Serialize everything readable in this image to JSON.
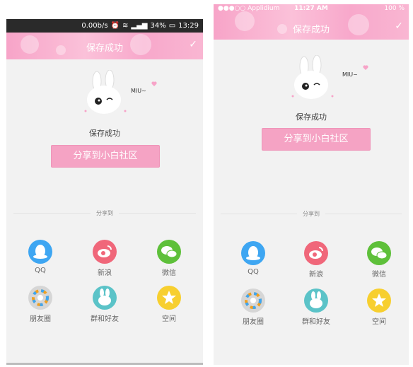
{
  "android_status": {
    "speed": "0.00b/s",
    "battery": "34%",
    "time": "13:29"
  },
  "ios_status": {
    "carrier": "●●●○○ Applidium",
    "time": "11:27 AM",
    "battery": "100 %"
  },
  "header": {
    "title": "保存成功",
    "check_icon": "check-icon"
  },
  "mascot": {
    "text": "MIU~"
  },
  "message": {
    "saved": "保存成功",
    "share_button": "分享到小白社区"
  },
  "share": {
    "label": "分享到",
    "items": [
      {
        "label": "QQ",
        "color": "#3ea6f2"
      },
      {
        "label": "新浪",
        "color": "#f0677a"
      },
      {
        "label": "微信",
        "color": "#5ec03a"
      },
      {
        "label": "朋友圈",
        "color": "#d6d6d6"
      },
      {
        "label": "群和好友",
        "color": "#5bc3c8"
      },
      {
        "label": "空间",
        "color": "#f7cf2f"
      }
    ]
  }
}
